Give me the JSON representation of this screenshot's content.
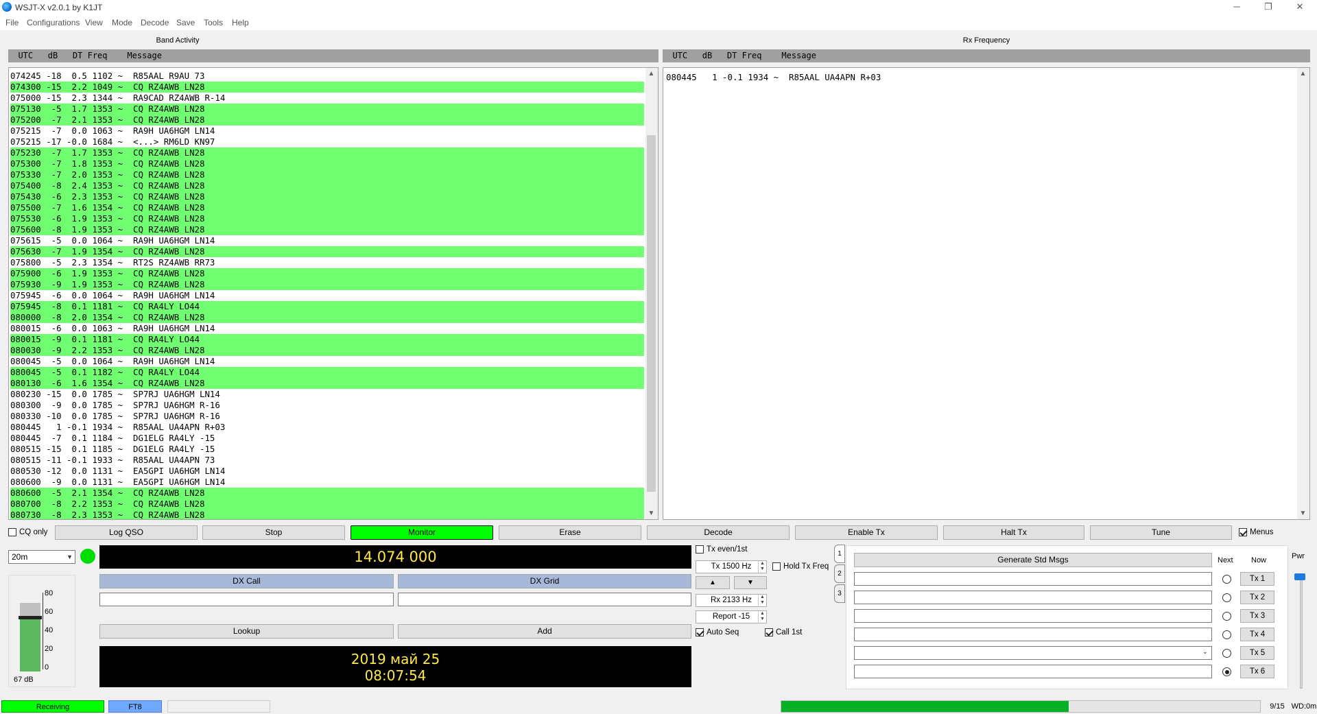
{
  "window": {
    "title": "WSJT-X   v2.0.1   by K1JT",
    "minimize": "─",
    "restore": "❐",
    "close": "✕"
  },
  "menu": [
    "File",
    "Configurations",
    "View",
    "Mode",
    "Decode",
    "Save",
    "Tools",
    "Help"
  ],
  "band_activity": {
    "title": "Band Activity",
    "header": "  UTC   dB   DT Freq    Message",
    "lines": [
      {
        "text": "074245 -18  0.5 1102 ~  R85AAL R9AU 73",
        "cq": false
      },
      {
        "text": "074300 -15  2.2 1049 ~  CQ RZ4AWB LN28",
        "cq": true
      },
      {
        "text": "075000 -15  2.3 1344 ~  RA9CAD RZ4AWB R-14",
        "cq": false
      },
      {
        "text": "075130  -5  1.7 1353 ~  CQ RZ4AWB LN28",
        "cq": true
      },
      {
        "text": "075200  -7  2.1 1353 ~  CQ RZ4AWB LN28",
        "cq": true
      },
      {
        "text": "075215  -7  0.0 1063 ~  RA9H UA6HGM LN14",
        "cq": false
      },
      {
        "text": "075215 -17 -0.0 1684 ~  <...> RM6LD KN97",
        "cq": false
      },
      {
        "text": "075230  -7  1.7 1353 ~  CQ RZ4AWB LN28",
        "cq": true
      },
      {
        "text": "075300  -7  1.8 1353 ~  CQ RZ4AWB LN28",
        "cq": true
      },
      {
        "text": "075330  -7  2.0 1353 ~  CQ RZ4AWB LN28",
        "cq": true
      },
      {
        "text": "075400  -8  2.4 1353 ~  CQ RZ4AWB LN28",
        "cq": true
      },
      {
        "text": "075430  -6  2.3 1353 ~  CQ RZ4AWB LN28",
        "cq": true
      },
      {
        "text": "075500  -7  1.6 1354 ~  CQ RZ4AWB LN28",
        "cq": true
      },
      {
        "text": "075530  -6  1.9 1353 ~  CQ RZ4AWB LN28",
        "cq": true
      },
      {
        "text": "075600  -8  1.9 1353 ~  CQ RZ4AWB LN28",
        "cq": true
      },
      {
        "text": "075615  -5  0.0 1064 ~  RA9H UA6HGM LN14",
        "cq": false
      },
      {
        "text": "075630  -7  1.9 1354 ~  CQ RZ4AWB LN28",
        "cq": true
      },
      {
        "text": "075800  -5  2.3 1354 ~  RT2S RZ4AWB RR73",
        "cq": false
      },
      {
        "text": "075900  -6  1.9 1353 ~  CQ RZ4AWB LN28",
        "cq": true
      },
      {
        "text": "075930  -9  1.9 1353 ~  CQ RZ4AWB LN28",
        "cq": true
      },
      {
        "text": "075945  -6  0.0 1064 ~  RA9H UA6HGM LN14",
        "cq": false
      },
      {
        "text": "075945  -8  0.1 1181 ~  CQ RA4LY LO44",
        "cq": true
      },
      {
        "text": "080000  -8  2.0 1354 ~  CQ RZ4AWB LN28",
        "cq": true
      },
      {
        "text": "080015  -6  0.0 1063 ~  RA9H UA6HGM LN14",
        "cq": false
      },
      {
        "text": "080015  -9  0.1 1181 ~  CQ RA4LY LO44",
        "cq": true
      },
      {
        "text": "080030  -9  2.2 1353 ~  CQ RZ4AWB LN28",
        "cq": true
      },
      {
        "text": "080045  -5  0.0 1064 ~  RA9H UA6HGM LN14",
        "cq": false
      },
      {
        "text": "080045  -5  0.1 1182 ~  CQ RA4LY LO44",
        "cq": true
      },
      {
        "text": "080130  -6  1.6 1354 ~  CQ RZ4AWB LN28",
        "cq": true
      },
      {
        "text": "080230 -15  0.0 1785 ~  SP7RJ UA6HGM LN14",
        "cq": false
      },
      {
        "text": "080300  -9  0.0 1785 ~  SP7RJ UA6HGM R-16",
        "cq": false
      },
      {
        "text": "080330 -10  0.0 1785 ~  SP7RJ UA6HGM R-16",
        "cq": false
      },
      {
        "text": "080445   1 -0.1 1934 ~  R85AAL UA4APN R+03",
        "cq": false
      },
      {
        "text": "080445  -7  0.1 1184 ~  DG1ELG RA4LY -15",
        "cq": false
      },
      {
        "text": "080515 -15  0.1 1185 ~  DG1ELG RA4LY -15",
        "cq": false
      },
      {
        "text": "080515 -11 -0.1 1933 ~  R85AAL UA4APN 73",
        "cq": false
      },
      {
        "text": "080530 -12  0.0 1131 ~  EA5GPI UA6HGM LN14",
        "cq": false
      },
      {
        "text": "080600  -9  0.0 1131 ~  EA5GPI UA6HGM LN14",
        "cq": false
      },
      {
        "text": "080600  -5  2.1 1354 ~  CQ RZ4AWB LN28",
        "cq": true
      },
      {
        "text": "080700  -8  2.2 1353 ~  CQ RZ4AWB LN28",
        "cq": true
      },
      {
        "text": "080730  -8  2.3 1353 ~  CQ RZ4AWB LN28",
        "cq": true
      }
    ]
  },
  "rx_frequency": {
    "title": "Rx Frequency",
    "header": "  UTC   dB   DT Freq    Message",
    "lines": [
      {
        "text": "080445   1 -0.1 1934 ~  R85AAL UA4APN R+03"
      }
    ]
  },
  "controls": {
    "cq_only": "CQ only",
    "log_qso": "Log QSO",
    "stop": "Stop",
    "monitor": "Monitor",
    "erase": "Erase",
    "decode": "Decode",
    "enable_tx": "Enable Tx",
    "halt_tx": "Halt Tx",
    "tune": "Tune",
    "menus": "Menus"
  },
  "band": {
    "selected": "20m",
    "frequency": "14.074 000"
  },
  "level": {
    "scale": [
      "80",
      "60",
      "40",
      "20",
      "0"
    ],
    "reading": "67 dB"
  },
  "dx": {
    "call_label": "DX Call",
    "grid_label": "DX Grid",
    "lookup": "Lookup",
    "add": "Add"
  },
  "clock": {
    "date": "2019 май 25",
    "time": "08:07:54"
  },
  "tx_options": {
    "tx_even": "Tx even/1st",
    "tx_freq": "Tx  1500  Hz",
    "hold_tx_freq": "Hold Tx Freq",
    "up": "▲",
    "down": "▼",
    "rx_freq": "Rx  2133  Hz",
    "report": "Report -15",
    "auto_seq": "Auto Seq",
    "call_1st": "Call 1st"
  },
  "tabs": [
    "1",
    "2",
    "3"
  ],
  "messages": {
    "generate": "Generate Std Msgs",
    "next_label": "Next",
    "now_label": "Now",
    "tx_buttons": [
      "Tx 1",
      "Tx 2",
      "Tx 3",
      "Tx 4",
      "Tx 5",
      "Tx 6"
    ],
    "selected_next": "Tx 6"
  },
  "pwr": {
    "label": "Pwr"
  },
  "status": {
    "state": "Receiving",
    "mode": "FT8",
    "progress_label": "9/15",
    "wd": "WD:0m",
    "progress": 0.6
  },
  "colors": {
    "cq_highlight": "#70ff70",
    "monitor": "#00ff00",
    "display_text": "#ffe84a"
  }
}
